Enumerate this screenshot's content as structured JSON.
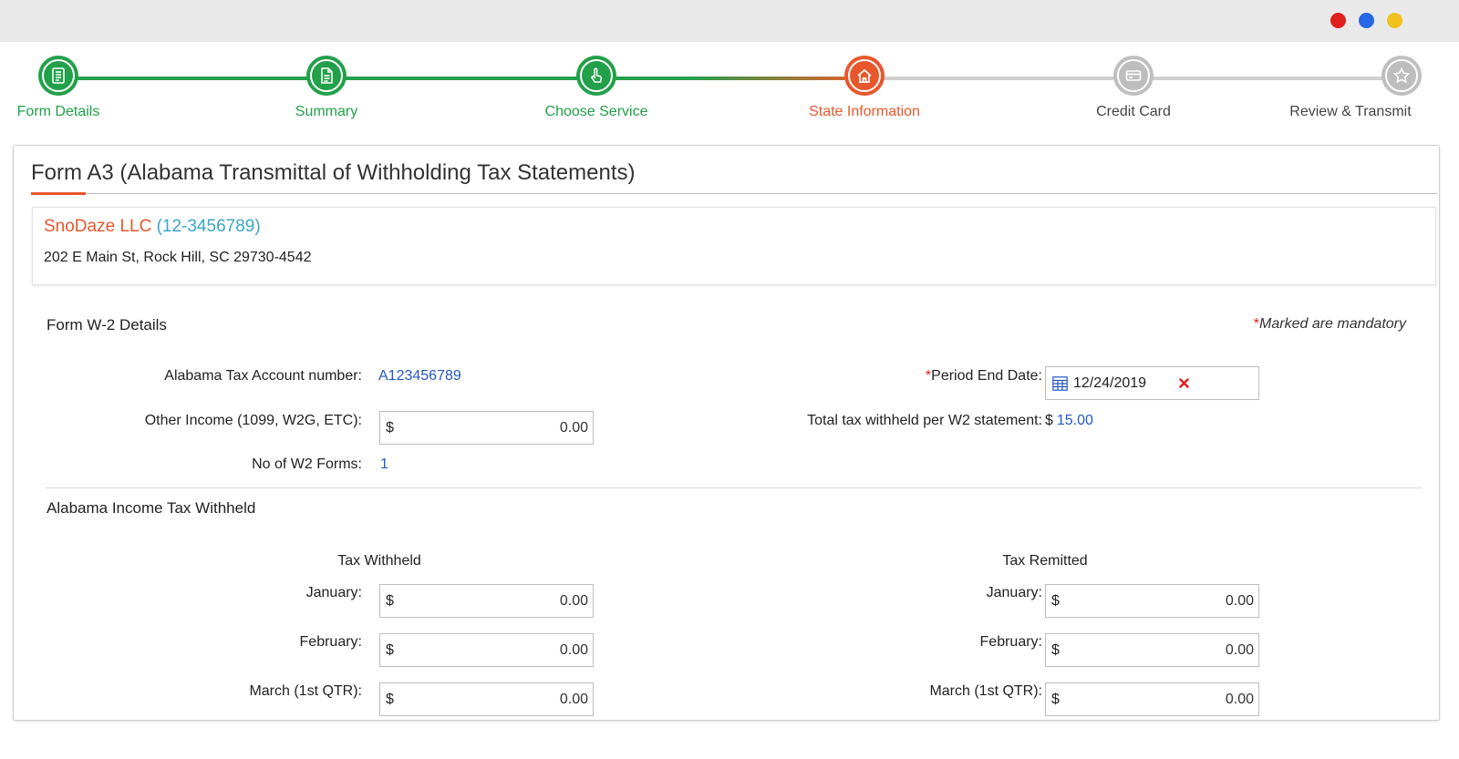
{
  "window": {
    "controls": [
      {
        "name": "close",
        "color": "#e0201c"
      },
      {
        "name": "minimize",
        "color": "#2668e8"
      },
      {
        "name": "maximize",
        "color": "#f1c21b"
      }
    ]
  },
  "stepper": {
    "steps": [
      {
        "label": "Form Details",
        "status": "completed",
        "icon": "document-icon"
      },
      {
        "label": "Summary",
        "status": "completed",
        "icon": "file-list-icon"
      },
      {
        "label": "Choose Service",
        "status": "completed",
        "icon": "hand-pointer-icon"
      },
      {
        "label": "State Information",
        "status": "current",
        "icon": "home-icon"
      },
      {
        "label": "Credit Card",
        "status": "pending",
        "icon": "credit-card-icon"
      },
      {
        "label": "Review & Transmit",
        "status": "pending",
        "icon": "star-icon"
      }
    ],
    "colors": {
      "completed": "#22a04a",
      "current": "#e8572c",
      "pending": "#bfbfbf"
    }
  },
  "form": {
    "title": "Form A3 (Alabama Transmittal of Withholding Tax Statements)"
  },
  "company": {
    "name": "SnoDaze LLC",
    "ein": "(12-3456789)",
    "address": "202 E Main St, Rock Hill, SC 29730-4542"
  },
  "w2_details": {
    "section_title": "Form W-2 Details",
    "mandatory_marker": "*",
    "mandatory_note": "Marked are mandatory",
    "account_label": "Alabama Tax Account number:",
    "account_value": "A123456789",
    "other_income_label": "Other Income (1099, W2G, ETC):",
    "other_income_currency": "$",
    "other_income_value": "0.00",
    "w2_count_label": "No of W2 Forms:",
    "w2_count_value": "1",
    "period_end_marker": "*",
    "period_end_label": "Period End Date:",
    "period_end_value": "12/24/2019",
    "total_tax_label": "Total tax withheld per W2 statement:",
    "total_tax_currency": "$",
    "total_tax_value": "15.00"
  },
  "income_tax": {
    "section_title": "Alabama Income Tax Withheld",
    "withheld_header": "Tax Withheld",
    "remitted_header": "Tax Remitted",
    "currency": "$",
    "months": [
      {
        "label": "January:",
        "withheld": "0.00",
        "remitted": "0.00"
      },
      {
        "label": "February:",
        "withheld": "0.00",
        "remitted": "0.00"
      },
      {
        "label": "March (1st QTR):",
        "withheld": "0.00",
        "remitted": "0.00"
      }
    ]
  }
}
